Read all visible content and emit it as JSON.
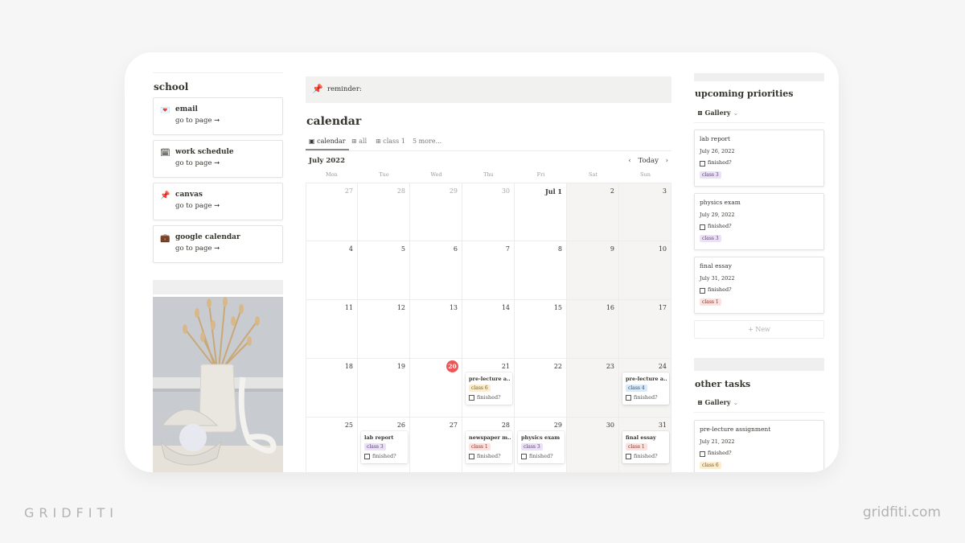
{
  "school": {
    "title": "school",
    "links": [
      {
        "icon": "love-letter-icon",
        "glyph": "💌",
        "name": "email",
        "action": "go to page ➞"
      },
      {
        "icon": "calendar-pad-icon",
        "glyph": "🗓",
        "name": "work schedule",
        "action": "go to page ➞"
      },
      {
        "icon": "pushpin-icon",
        "glyph": "📌",
        "name": "canvas",
        "action": "go to page ➞"
      },
      {
        "icon": "briefcase-icon",
        "glyph": "💼",
        "name": "google calendar",
        "action": "go to page ➞"
      }
    ]
  },
  "reminder": {
    "icon": "pushpin-icon",
    "glyph": "📌",
    "text": "reminder:"
  },
  "calendar": {
    "title": "calendar",
    "tabs": [
      {
        "label": "calendar",
        "icon": "calendar-icon",
        "glyph": "▣",
        "active": true
      },
      {
        "label": "all",
        "icon": "table-icon",
        "glyph": "⊞",
        "active": false
      },
      {
        "label": "class 1",
        "icon": "table-icon",
        "glyph": "⊞",
        "active": false
      },
      {
        "label": "5 more...",
        "icon": "",
        "glyph": "",
        "active": false
      }
    ],
    "month": "July 2022",
    "nav": {
      "prev": "‹",
      "today": "Today",
      "next": "›"
    },
    "weekdays": [
      "Mon",
      "Tue",
      "Wed",
      "Thu",
      "Fri",
      "Sat",
      "Sun"
    ],
    "weeks": [
      [
        {
          "d": "27",
          "other": true
        },
        {
          "d": "28",
          "other": true
        },
        {
          "d": "29",
          "other": true
        },
        {
          "d": "30",
          "other": true
        },
        {
          "d": "Jul 1",
          "bold": true
        },
        {
          "d": "2"
        },
        {
          "d": "3"
        }
      ],
      [
        {
          "d": "4"
        },
        {
          "d": "5"
        },
        {
          "d": "6"
        },
        {
          "d": "7"
        },
        {
          "d": "8"
        },
        {
          "d": "9"
        },
        {
          "d": "10"
        }
      ],
      [
        {
          "d": "11"
        },
        {
          "d": "12"
        },
        {
          "d": "13"
        },
        {
          "d": "14"
        },
        {
          "d": "15"
        },
        {
          "d": "16"
        },
        {
          "d": "17"
        }
      ],
      [
        {
          "d": "18"
        },
        {
          "d": "19"
        },
        {
          "d": "20",
          "today": true
        },
        {
          "d": "21",
          "event": {
            "title": "pre-lecture a...",
            "tag": "class 6",
            "color": "yellow",
            "check": "finished?"
          }
        },
        {
          "d": "22"
        },
        {
          "d": "23"
        },
        {
          "d": "24",
          "event": {
            "title": "pre-lecture a...",
            "tag": "class 4",
            "color": "blue",
            "check": "finished?"
          }
        }
      ],
      [
        {
          "d": "25"
        },
        {
          "d": "26",
          "event": {
            "title": "lab report",
            "tag": "class 3",
            "color": "purple",
            "check": "finished?"
          }
        },
        {
          "d": "27"
        },
        {
          "d": "28",
          "event": {
            "title": "newspaper m...",
            "tag": "class 1",
            "color": "red",
            "check": "finished?"
          }
        },
        {
          "d": "29",
          "event": {
            "title": "physics exam",
            "tag": "class 3",
            "color": "purple",
            "check": "finished?"
          }
        },
        {
          "d": "30"
        },
        {
          "d": "31",
          "event": {
            "title": "final essay",
            "tag": "class 1",
            "color": "red",
            "check": "finished?"
          }
        }
      ]
    ]
  },
  "priorities": {
    "title": "upcoming priorities",
    "view": "Gallery",
    "cards": [
      {
        "title": "lab report",
        "date": "July 26, 2022",
        "check": "finished?",
        "tag": "class 3",
        "color": "purple"
      },
      {
        "title": "physics exam",
        "date": "July 29, 2022",
        "check": "finished?",
        "tag": "class 3",
        "color": "purple"
      },
      {
        "title": "final essay",
        "date": "July 31, 2022",
        "check": "finished?",
        "tag": "class 1",
        "color": "red"
      }
    ],
    "new_label": "+ New"
  },
  "other_tasks": {
    "title": "other tasks",
    "view": "Gallery",
    "cards": [
      {
        "title": "pre-lecture assignment",
        "date": "July 21, 2022",
        "check": "finished?",
        "tag": "class 6",
        "color": "yellow"
      }
    ]
  },
  "footer": {
    "brand_left": "GRIDFITI",
    "brand_right": "gridfiti.com"
  },
  "colors": {
    "today": "#eb5757",
    "purple_tag": "#ebe1f4",
    "red_tag": "#fbe2df",
    "yellow_tag": "#fbedd0",
    "blue_tag": "#dbe9f6"
  }
}
